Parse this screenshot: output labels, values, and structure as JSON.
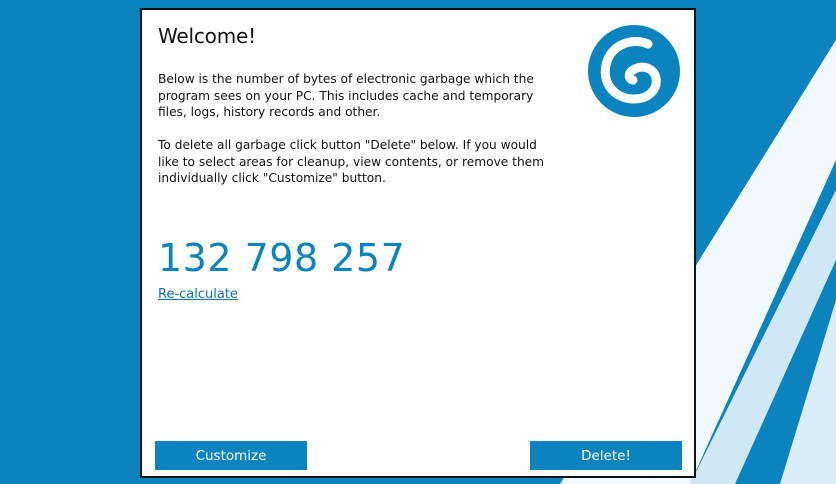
{
  "colors": {
    "accent": "#0a83bf",
    "link": "#0a6fae",
    "background": "#0a83bf",
    "dialog_bg": "#ffffff"
  },
  "dialog": {
    "title": "Welcome!",
    "intro_text": "Below is the number of bytes of electronic garbage which the program sees on your PC. This includes cache and temporary files, logs, history records and other.",
    "instruction_text": "To delete all garbage click button \"Delete\" below. If you would like to select areas for cleanup, view contents, or remove them individually click \"Customize\" button.",
    "garbage_bytes": "132 798 257",
    "recalculate_link": "Re-calculate",
    "logo_icon": "app-logo-g-icon"
  },
  "buttons": {
    "customize_label": "Customize",
    "delete_label": "Delete!"
  }
}
